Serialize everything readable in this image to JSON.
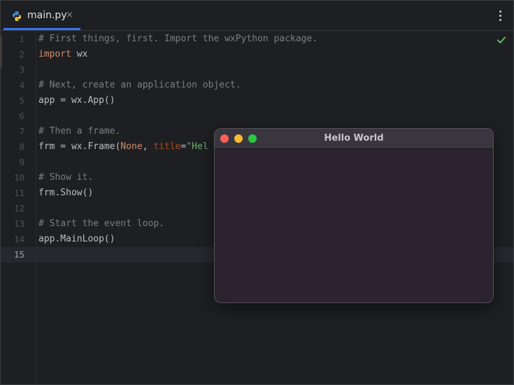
{
  "tab": {
    "label": "main.py",
    "close": "×",
    "icon": "python-icon"
  },
  "more_menu_icon": "more-vertical-icon",
  "status_icon": "check-icon",
  "colors": {
    "accent": "#3574f0",
    "check": "#5fb865",
    "traffic_close": "#ff5f57",
    "traffic_minimize": "#febc2e",
    "traffic_zoom": "#28c840"
  },
  "editor": {
    "current_line": 15,
    "lines": [
      {
        "n": "1",
        "tokens": [
          {
            "t": "# First things, first. Import the wxPython package.",
            "c": "comment"
          }
        ]
      },
      {
        "n": "2",
        "tokens": [
          {
            "t": "import",
            "c": "kw"
          },
          {
            "t": " wx",
            "c": "plain"
          }
        ]
      },
      {
        "n": "3",
        "tokens": []
      },
      {
        "n": "4",
        "tokens": [
          {
            "t": "# Next, create an application object.",
            "c": "comment"
          }
        ]
      },
      {
        "n": "5",
        "tokens": [
          {
            "t": "app = wx.App()",
            "c": "plain"
          }
        ]
      },
      {
        "n": "6",
        "tokens": []
      },
      {
        "n": "7",
        "tokens": [
          {
            "t": "# Then a frame.",
            "c": "comment"
          }
        ]
      },
      {
        "n": "8",
        "tokens": [
          {
            "t": "frm = wx.Frame(",
            "c": "plain"
          },
          {
            "t": "None",
            "c": "kw"
          },
          {
            "t": ", ",
            "c": "plain"
          },
          {
            "t": "title",
            "c": "param"
          },
          {
            "t": "=",
            "c": "plain"
          },
          {
            "t": "\"Hel",
            "c": "str"
          }
        ]
      },
      {
        "n": "9",
        "tokens": []
      },
      {
        "n": "10",
        "tokens": [
          {
            "t": "# Show it.",
            "c": "comment"
          }
        ]
      },
      {
        "n": "11",
        "tokens": [
          {
            "t": "frm.Show()",
            "c": "plain"
          }
        ]
      },
      {
        "n": "12",
        "tokens": []
      },
      {
        "n": "13",
        "tokens": [
          {
            "t": "# Start the event loop.",
            "c": "comment"
          }
        ]
      },
      {
        "n": "14",
        "tokens": [
          {
            "t": "app.MainLoop()",
            "c": "plain"
          }
        ]
      },
      {
        "n": "15",
        "tokens": []
      }
    ]
  },
  "window": {
    "title": "Hello World"
  }
}
